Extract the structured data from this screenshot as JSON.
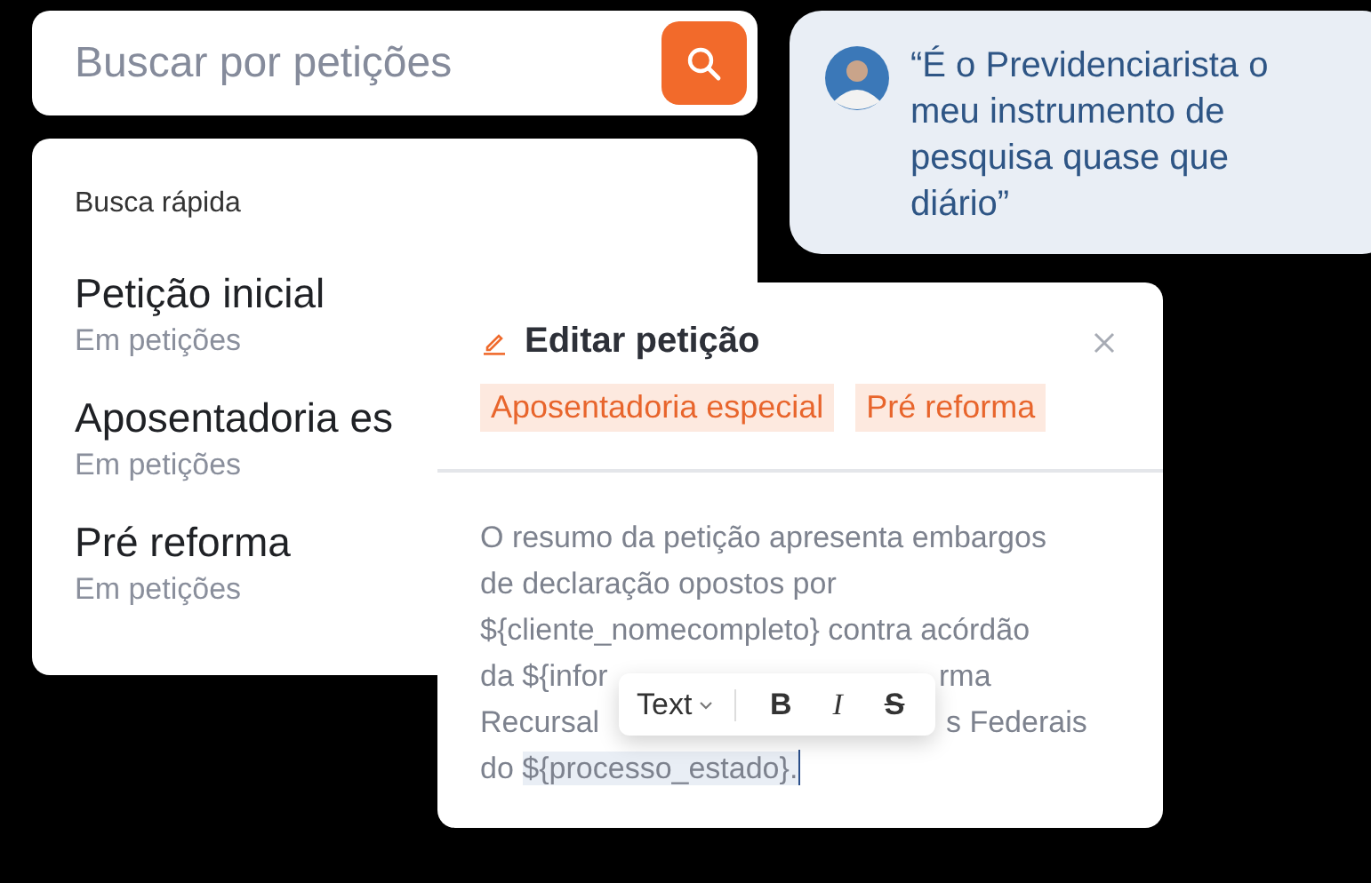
{
  "search": {
    "placeholder": "Buscar por petições"
  },
  "quick_search": {
    "title": "Busca rápida",
    "items": [
      {
        "title": "Petição inicial",
        "subtitle": "Em petições"
      },
      {
        "title": "Aposentadoria es",
        "subtitle": "Em petições"
      },
      {
        "title": "Pré reforma",
        "subtitle": "Em petições"
      }
    ]
  },
  "testimonial": {
    "quote": "“É o Previdenciarista o meu instrumento de pesquisa quase que diário”"
  },
  "editor": {
    "title": "Editar petição",
    "tags": [
      "Aposentadoria especial",
      "Pré reforma"
    ],
    "lines": [
      [
        {
          "text": "O resumo da petição apresenta embargos",
          "selected": false
        }
      ],
      [
        {
          "text": "de declaração opostos por",
          "selected": false
        }
      ],
      [
        {
          "text": "${cliente_nomecompleto} contra acórdão",
          "selected": false
        }
      ],
      [
        {
          "text": "da ${infor",
          "selected": false
        },
        {
          "text": "rma",
          "selected": false
        }
      ],
      [
        {
          "text": "Recursal",
          "selected": false
        },
        {
          "text": "s Federais",
          "selected": false
        }
      ],
      [
        {
          "text": "do",
          "selected": false
        },
        {
          "text": "${processo_estado}.",
          "selected": true
        }
      ]
    ],
    "toolbar": {
      "format": "Text",
      "buttons": [
        {
          "label": "B",
          "kind": "bold"
        },
        {
          "label": "I",
          "kind": "italic"
        },
        {
          "label": "S",
          "kind": "strike"
        }
      ]
    }
  }
}
